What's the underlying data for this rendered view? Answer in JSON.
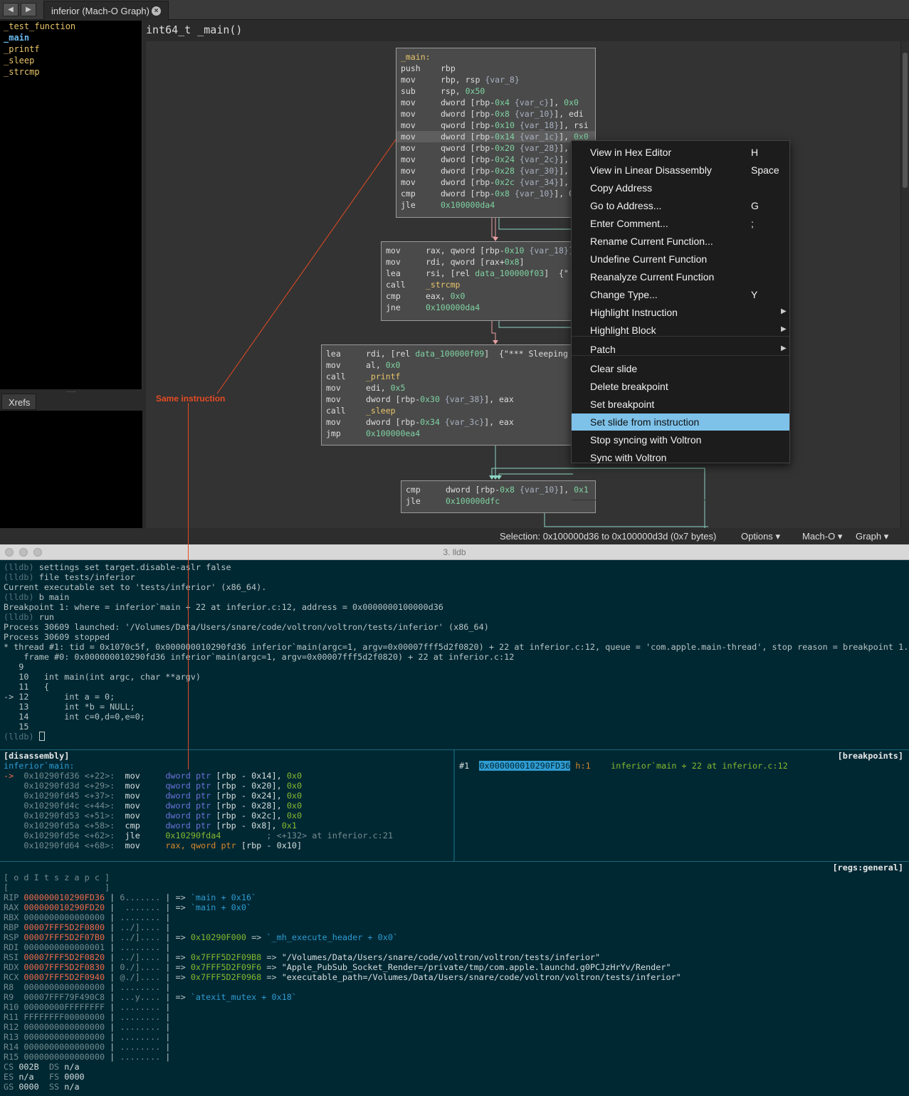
{
  "tab": {
    "title": "inferior (Mach-O Graph)"
  },
  "sidebar": {
    "functions": [
      "_test_function",
      "_main",
      "_printf",
      "_sleep",
      "_strcmp"
    ],
    "xrefs_tab": "Xrefs"
  },
  "function_header": "int64_t _main()",
  "annotation": "Same instruction",
  "blocks": {
    "b1": {
      "label": "_main:",
      "lines": [
        [
          "push",
          "rbp"
        ],
        [
          "mov",
          "rbp, rsp {var_8}"
        ],
        [
          "sub",
          "rsp, 0x50"
        ],
        [
          "mov",
          "dword [rbp-0x4 {var_c}], 0x0"
        ],
        [
          "mov",
          "dword [rbp-0x8 {var_10}], edi"
        ],
        [
          "mov",
          "qword [rbp-0x10 {var_18}], rsi"
        ],
        [
          "mov",
          "dword [rbp-0x14 {var_1c}], 0x0"
        ],
        [
          "mov",
          "qword [rbp-0x20 {var_28}], 0"
        ],
        [
          "mov",
          "dword [rbp-0x24 {var_2c}], 0"
        ],
        [
          "mov",
          "dword [rbp-0x28 {var_30}], 0"
        ],
        [
          "mov",
          "dword [rbp-0x2c {var_34}], 0"
        ],
        [
          "cmp",
          "dword [rbp-0x8 {var_10}], 0"
        ],
        [
          "jle",
          "0x100000da4"
        ]
      ]
    },
    "b2": {
      "lines": [
        [
          "mov",
          "rax, qword [rbp-0x10 {var_18}]"
        ],
        [
          "mov",
          "rdi, qword [rax+0x8]"
        ],
        [
          "lea",
          "rsi, [rel data_100000f03]  {\""
        ],
        [
          "call",
          "_strcmp"
        ],
        [
          "cmp",
          "eax, 0x0"
        ],
        [
          "jne",
          "0x100000da4"
        ]
      ]
    },
    "b3": {
      "lines": [
        [
          "lea",
          "rdi, [rel data_100000f09]  {\"*** Sleeping"
        ],
        [
          "mov",
          "al, 0x0"
        ],
        [
          "call",
          "_printf"
        ],
        [
          "mov",
          "edi, 0x5"
        ],
        [
          "mov",
          "dword [rbp-0x30 {var_38}], eax"
        ],
        [
          "call",
          "_sleep"
        ],
        [
          "mov",
          "dword [rbp-0x34 {var_3c}], eax"
        ],
        [
          "jmp",
          "0x100000ea4"
        ]
      ]
    },
    "b4": {
      "lines": [
        [
          "cmp",
          "dword [rbp-0x8 {var_10}], 0x1"
        ],
        [
          "jle",
          "0x100000dfc"
        ]
      ]
    }
  },
  "context_menu": [
    {
      "label": "View in Hex Editor",
      "shortcut": "H"
    },
    {
      "label": "View in Linear Disassembly",
      "shortcut": "Space"
    },
    {
      "label": "Copy Address",
      "shortcut": ""
    },
    {
      "label": "Go to Address...",
      "shortcut": "G"
    },
    {
      "label": "Enter Comment...",
      "shortcut": ";"
    },
    {
      "label": "Rename Current Function...",
      "shortcut": ""
    },
    {
      "label": "Undefine Current Function",
      "shortcut": ""
    },
    {
      "label": "Reanalyze Current Function",
      "shortcut": ""
    },
    {
      "label": "Change Type...",
      "shortcut": "Y"
    },
    {
      "label": "Highlight Instruction",
      "shortcut": ""
    },
    {
      "label": "Highlight Block",
      "shortcut": ""
    },
    {
      "label": "Patch",
      "shortcut": ""
    },
    {
      "label": "Clear slide",
      "shortcut": ""
    },
    {
      "label": "Delete breakpoint",
      "shortcut": ""
    },
    {
      "label": "Set breakpoint",
      "shortcut": ""
    },
    {
      "label": "Set slide from instruction",
      "shortcut": ""
    },
    {
      "label": "Stop syncing with Voltron",
      "shortcut": ""
    },
    {
      "label": "Sync with Voltron",
      "shortcut": ""
    }
  ],
  "statusbar": {
    "selection": "Selection: 0x100000d36 to 0x100000d3d (0x7 bytes)",
    "options": "Options",
    "format": "Mach-O",
    "view": "Graph"
  },
  "terminal": {
    "title": "3. lldb",
    "lines": [
      {
        "p": "(lldb)",
        "t": " settings set target.disable-aslr false"
      },
      {
        "p": "(lldb)",
        "t": " file tests/inferior"
      },
      {
        "p": "",
        "t": "Current executable set to 'tests/inferior' (x86_64)."
      },
      {
        "p": "(lldb)",
        "t": " b main"
      },
      {
        "p": "",
        "t": "Breakpoint 1: where = inferior`main + 22 at inferior.c:12, address = 0x0000000100000d36"
      },
      {
        "p": "(lldb)",
        "t": " run"
      },
      {
        "p": "",
        "t": "Process 30609 launched: '/Volumes/Data/Users/snare/code/voltron/voltron/tests/inferior' (x86_64)"
      },
      {
        "p": "",
        "t": "Process 30609 stopped"
      },
      {
        "p": "",
        "t": "* thread #1: tid = 0x1070c5f, 0x000000010290fd36 inferior`main(argc=1, argv=0x00007fff5d2f0820) + 22 at inferior.c:12, queue = 'com.apple.main-thread', stop reason = breakpoint 1.1"
      },
      {
        "p": "",
        "t": "    frame #0: 0x000000010290fd36 inferior`main(argc=1, argv=0x00007fff5d2f0820) + 22 at inferior.c:12"
      },
      {
        "p": "",
        "t": "   9"
      },
      {
        "p": "",
        "t": "   10   int main(int argc, char **argv)"
      },
      {
        "p": "",
        "t": "   11   {"
      },
      {
        "p": "",
        "t": "-> 12       int a = 0;"
      },
      {
        "p": "",
        "t": "   13       int *b = NULL;"
      },
      {
        "p": "",
        "t": "   14       int c=0,d=0,e=0;"
      },
      {
        "p": "",
        "t": "   15"
      }
    ],
    "prompt": "(lldb)"
  },
  "disassembly": {
    "header": "[disassembly]",
    "func": "inferior`main:",
    "rows": [
      {
        "m": "->",
        "a": "0x10290fd36",
        "o": "<+22>:",
        "op": "mov",
        "ptr": "dword ptr",
        "arg": "[rbp - 0x14]",
        "v": "0x0"
      },
      {
        "m": "",
        "a": "0x10290fd3d",
        "o": "<+29>:",
        "op": "mov",
        "ptr": "qword ptr",
        "arg": "[rbp - 0x20]",
        "v": "0x0"
      },
      {
        "m": "",
        "a": "0x10290fd45",
        "o": "<+37>:",
        "op": "mov",
        "ptr": "dword ptr",
        "arg": "[rbp - 0x24]",
        "v": "0x0"
      },
      {
        "m": "",
        "a": "0x10290fd4c",
        "o": "<+44>:",
        "op": "mov",
        "ptr": "dword ptr",
        "arg": "[rbp - 0x28]",
        "v": "0x0"
      },
      {
        "m": "",
        "a": "0x10290fd53",
        "o": "<+51>:",
        "op": "mov",
        "ptr": "dword ptr",
        "arg": "[rbp - 0x2c]",
        "v": "0x0"
      },
      {
        "m": "",
        "a": "0x10290fd5a",
        "o": "<+58>:",
        "op": "cmp",
        "ptr": "dword ptr",
        "arg": "[rbp - 0x8]",
        "v": "0x1"
      },
      {
        "m": "",
        "a": "0x10290fd5e",
        "o": "<+62>:",
        "op": "jle",
        "ptr": "",
        "arg": "0x10290fda4",
        "v": "; <+132> at inferior.c:21"
      },
      {
        "m": "",
        "a": "0x10290fd64",
        "o": "<+68>:",
        "op": "mov",
        "ptr": "rax, qword ptr",
        "arg": "[rbp - 0x10]",
        "v": ""
      }
    ]
  },
  "breakpoints": {
    "header": "[breakpoints]",
    "num": "#1",
    "addr": "0x000000010290FD36",
    "hits": "h:1",
    "loc": "inferior`main + 22 at inferior.c:12"
  },
  "registers": {
    "header": "[regs:general]",
    "flags": "[ o d I t s z a p c ]",
    "flags_vals": "[                   ]",
    "rows": [
      {
        "n": "RIP",
        "v": "000000010290FD36",
        "c": "6.......",
        "d": "=> `main + 0x16`",
        "hot": true
      },
      {
        "n": "RAX",
        "v": "000000010290FD20",
        "c": " .......",
        "d": "=> `main + 0x0`",
        "hot": true
      },
      {
        "n": "RBX",
        "v": "0000000000000000",
        "c": "........",
        "d": ""
      },
      {
        "n": "RBP",
        "v": "00007FFF5D2F0800",
        "c": "../]....",
        "d": "",
        "hot": true
      },
      {
        "n": "RSP",
        "v": "00007FFF5D2F07B0",
        "c": "../]....",
        "d": "=> 0x10290F000 => `_mh_execute_header + 0x0`",
        "hot": true
      },
      {
        "n": "RDI",
        "v": "0000000000000001",
        "c": "........",
        "d": ""
      },
      {
        "n": "RSI",
        "v": "00007FFF5D2F0820",
        "c": "../]....",
        "d": "=> 0x7FFF5D2F09B8 => \"/Volumes/Data/Users/snare/code/voltron/voltron/tests/inferior\"",
        "hot": true
      },
      {
        "n": "RDX",
        "v": "00007FFF5D2F0830",
        "c": "0./]....",
        "d": "=> 0x7FFF5D2F09F6 => \"Apple_PubSub_Socket_Render=/private/tmp/com.apple.launchd.g0PCJzHrYv/Render\"",
        "hot": true
      },
      {
        "n": "RCX",
        "v": "00007FFF5D2F0940",
        "c": "@./]....",
        "d": "=> 0x7FFF5D2F0968 => \"executable_path=/Volumes/Data/Users/snare/code/voltron/voltron/tests/inferior\"",
        "hot": true
      },
      {
        "n": "R8",
        "v": "0000000000000000",
        "c": "........",
        "d": ""
      },
      {
        "n": "R9",
        "v": "00007FFF79F490C8",
        "c": "...y....",
        "d": "=> `atexit_mutex + 0x18`"
      },
      {
        "n": "R10",
        "v": "00000000FFFFFFFF",
        "c": "........",
        "d": ""
      },
      {
        "n": "R11",
        "v": "FFFFFFFF00000000",
        "c": "........",
        "d": ""
      },
      {
        "n": "R12",
        "v": "0000000000000000",
        "c": "........",
        "d": ""
      },
      {
        "n": "R13",
        "v": "0000000000000000",
        "c": "........",
        "d": ""
      },
      {
        "n": "R14",
        "v": "0000000000000000",
        "c": "........",
        "d": ""
      },
      {
        "n": "R15",
        "v": "0000000000000000",
        "c": "........",
        "d": ""
      }
    ],
    "segs": [
      [
        "CS",
        "002B",
        "DS",
        "n/a"
      ],
      [
        "ES",
        "n/a",
        "FS",
        "0000"
      ],
      [
        "GS",
        "0000",
        "SS",
        "n/a"
      ]
    ]
  }
}
